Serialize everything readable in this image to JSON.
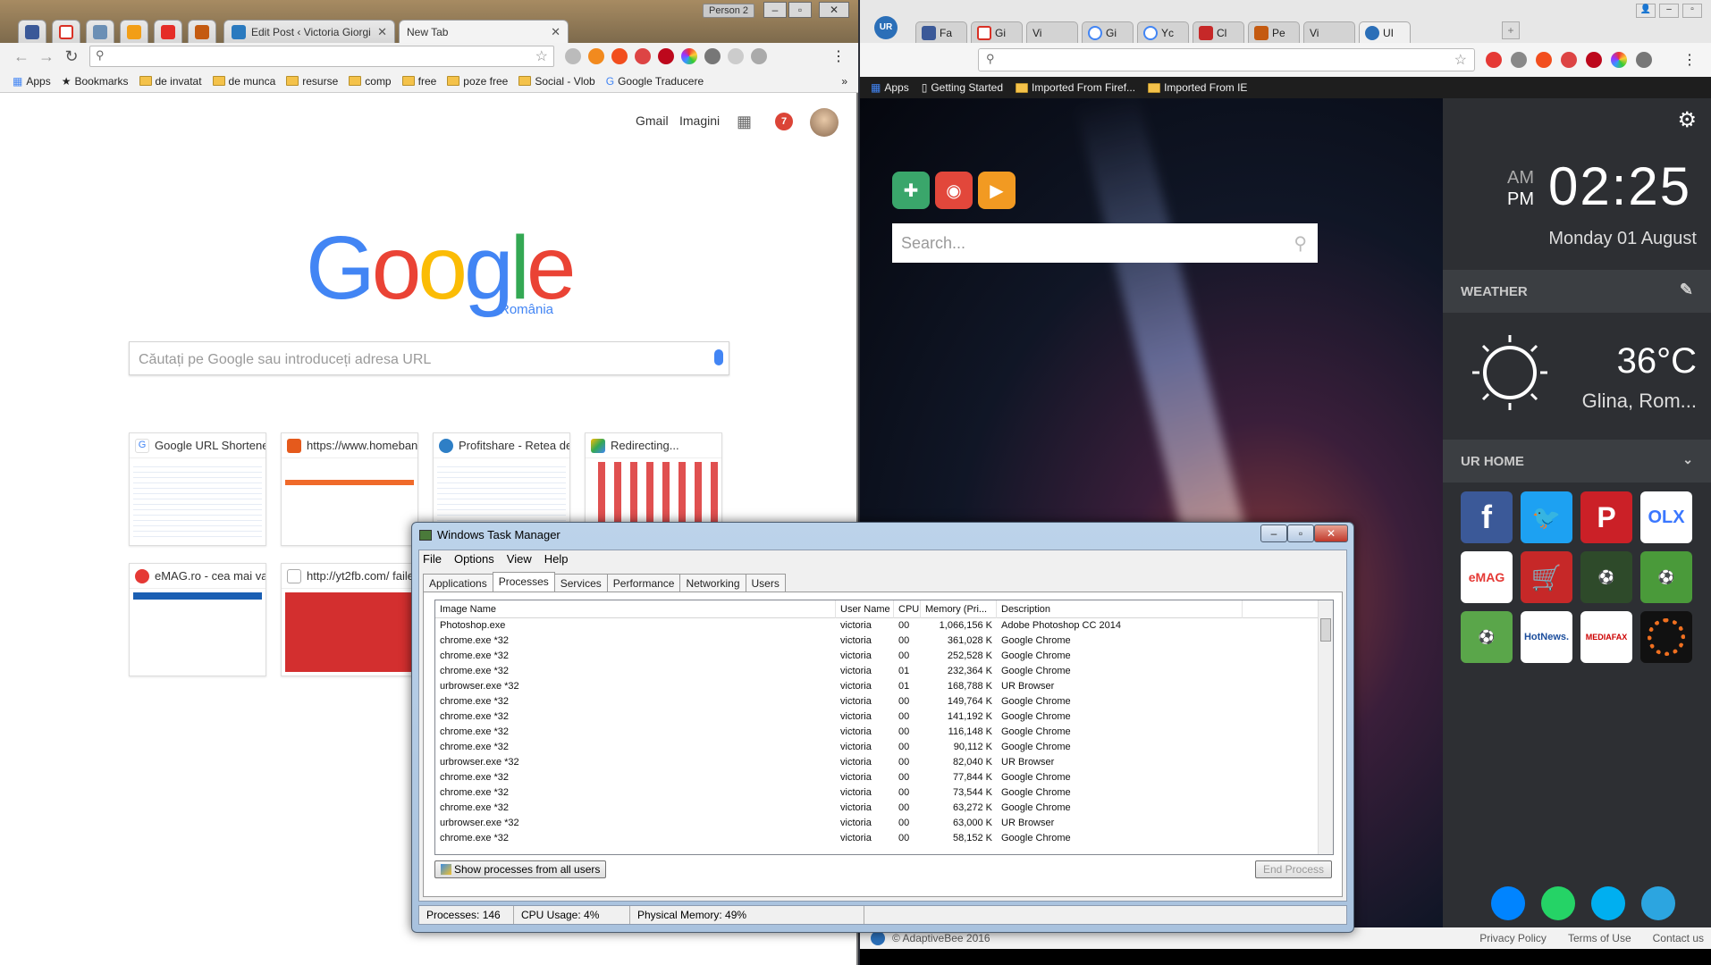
{
  "left_browser": {
    "tabs": [
      {
        "label": "Edit Post ‹ Victoria Giorgi",
        "color": "#2a7abf"
      },
      {
        "label": "New Tab",
        "color": ""
      }
    ],
    "person_label": "Person 2",
    "bookmarks": [
      "Apps",
      "Bookmarks",
      "de invatat",
      "de munca",
      "resurse",
      "comp",
      "free",
      "poze free",
      "Social - Vlob",
      "Google Traducere"
    ],
    "top_links": {
      "gmail": "Gmail",
      "images": "Imagini",
      "notif_count": "7"
    },
    "google": {
      "logo": "Google",
      "country": "România",
      "placeholder": "Căutați pe Google sau introduceți adresa URL"
    },
    "tiles": [
      {
        "title": "Google URL Shortener"
      },
      {
        "title": "https://www.homebank"
      },
      {
        "title": "Profitshare - Retea de"
      },
      {
        "title": "Redirecting..."
      },
      {
        "title": "eMAG.ro - cea mai va"
      },
      {
        "title": "http://yt2fb.com/ faile"
      }
    ]
  },
  "right_browser": {
    "tabs": [
      "Fa",
      "Gi",
      "Vi",
      "Gi",
      "Yc",
      "Cl",
      "Pe",
      "Vi",
      "UI"
    ],
    "bookmarks": [
      "Apps",
      "Getting Started",
      "Imported From Firef...",
      "Imported From IE"
    ],
    "search_placeholder": "Search...",
    "clock": {
      "am": "AM",
      "pm": "PM",
      "time": "02:25",
      "date": "Monday 01 August"
    },
    "weather": {
      "title": "WEATHER",
      "temp": "36°C",
      "location": "Glina, Rom..."
    },
    "ur_home": {
      "title": "UR HOME",
      "apps": [
        "f",
        "twitter",
        "P",
        "OLX",
        "eMAG",
        "cart",
        "game",
        "soccer",
        "player",
        "HotNews.",
        "MEDIAFAX",
        "orb"
      ]
    },
    "footer": {
      "copyright": "© AdaptiveBee 2016",
      "privacy": "Privacy Policy",
      "terms": "Terms of Use",
      "contact": "Contact us"
    }
  },
  "task_manager": {
    "title": "Windows Task Manager",
    "menu": [
      "File",
      "Options",
      "View",
      "Help"
    ],
    "tabs": [
      "Applications",
      "Processes",
      "Services",
      "Performance",
      "Networking",
      "Users"
    ],
    "columns": [
      "Image Name",
      "User Name",
      "CPU",
      "Memory (Pri...",
      "Description"
    ],
    "rows": [
      [
        "Photoshop.exe",
        "victoria",
        "00",
        "1,066,156 K",
        "Adobe Photoshop CC 2014"
      ],
      [
        "chrome.exe *32",
        "victoria",
        "00",
        "361,028 K",
        "Google Chrome"
      ],
      [
        "chrome.exe *32",
        "victoria",
        "00",
        "252,528 K",
        "Google Chrome"
      ],
      [
        "chrome.exe *32",
        "victoria",
        "01",
        "232,364 K",
        "Google Chrome"
      ],
      [
        "urbrowser.exe *32",
        "victoria",
        "01",
        "168,788 K",
        "UR Browser"
      ],
      [
        "chrome.exe *32",
        "victoria",
        "00",
        "149,764 K",
        "Google Chrome"
      ],
      [
        "chrome.exe *32",
        "victoria",
        "00",
        "141,192 K",
        "Google Chrome"
      ],
      [
        "chrome.exe *32",
        "victoria",
        "00",
        "116,148 K",
        "Google Chrome"
      ],
      [
        "chrome.exe *32",
        "victoria",
        "00",
        "90,112 K",
        "Google Chrome"
      ],
      [
        "urbrowser.exe *32",
        "victoria",
        "00",
        "82,040 K",
        "UR Browser"
      ],
      [
        "chrome.exe *32",
        "victoria",
        "00",
        "77,844 K",
        "Google Chrome"
      ],
      [
        "chrome.exe *32",
        "victoria",
        "00",
        "73,544 K",
        "Google Chrome"
      ],
      [
        "chrome.exe *32",
        "victoria",
        "00",
        "63,272 K",
        "Google Chrome"
      ],
      [
        "urbrowser.exe *32",
        "victoria",
        "00",
        "63,000 K",
        "UR Browser"
      ],
      [
        "chrome.exe *32",
        "victoria",
        "00",
        "58,152 K",
        "Google Chrome"
      ]
    ],
    "show_all": "Show processes from all users",
    "end_process": "End Process",
    "status": {
      "processes": "Processes: 146",
      "cpu": "CPU Usage: 4%",
      "memory": "Physical Memory: 49%"
    }
  }
}
